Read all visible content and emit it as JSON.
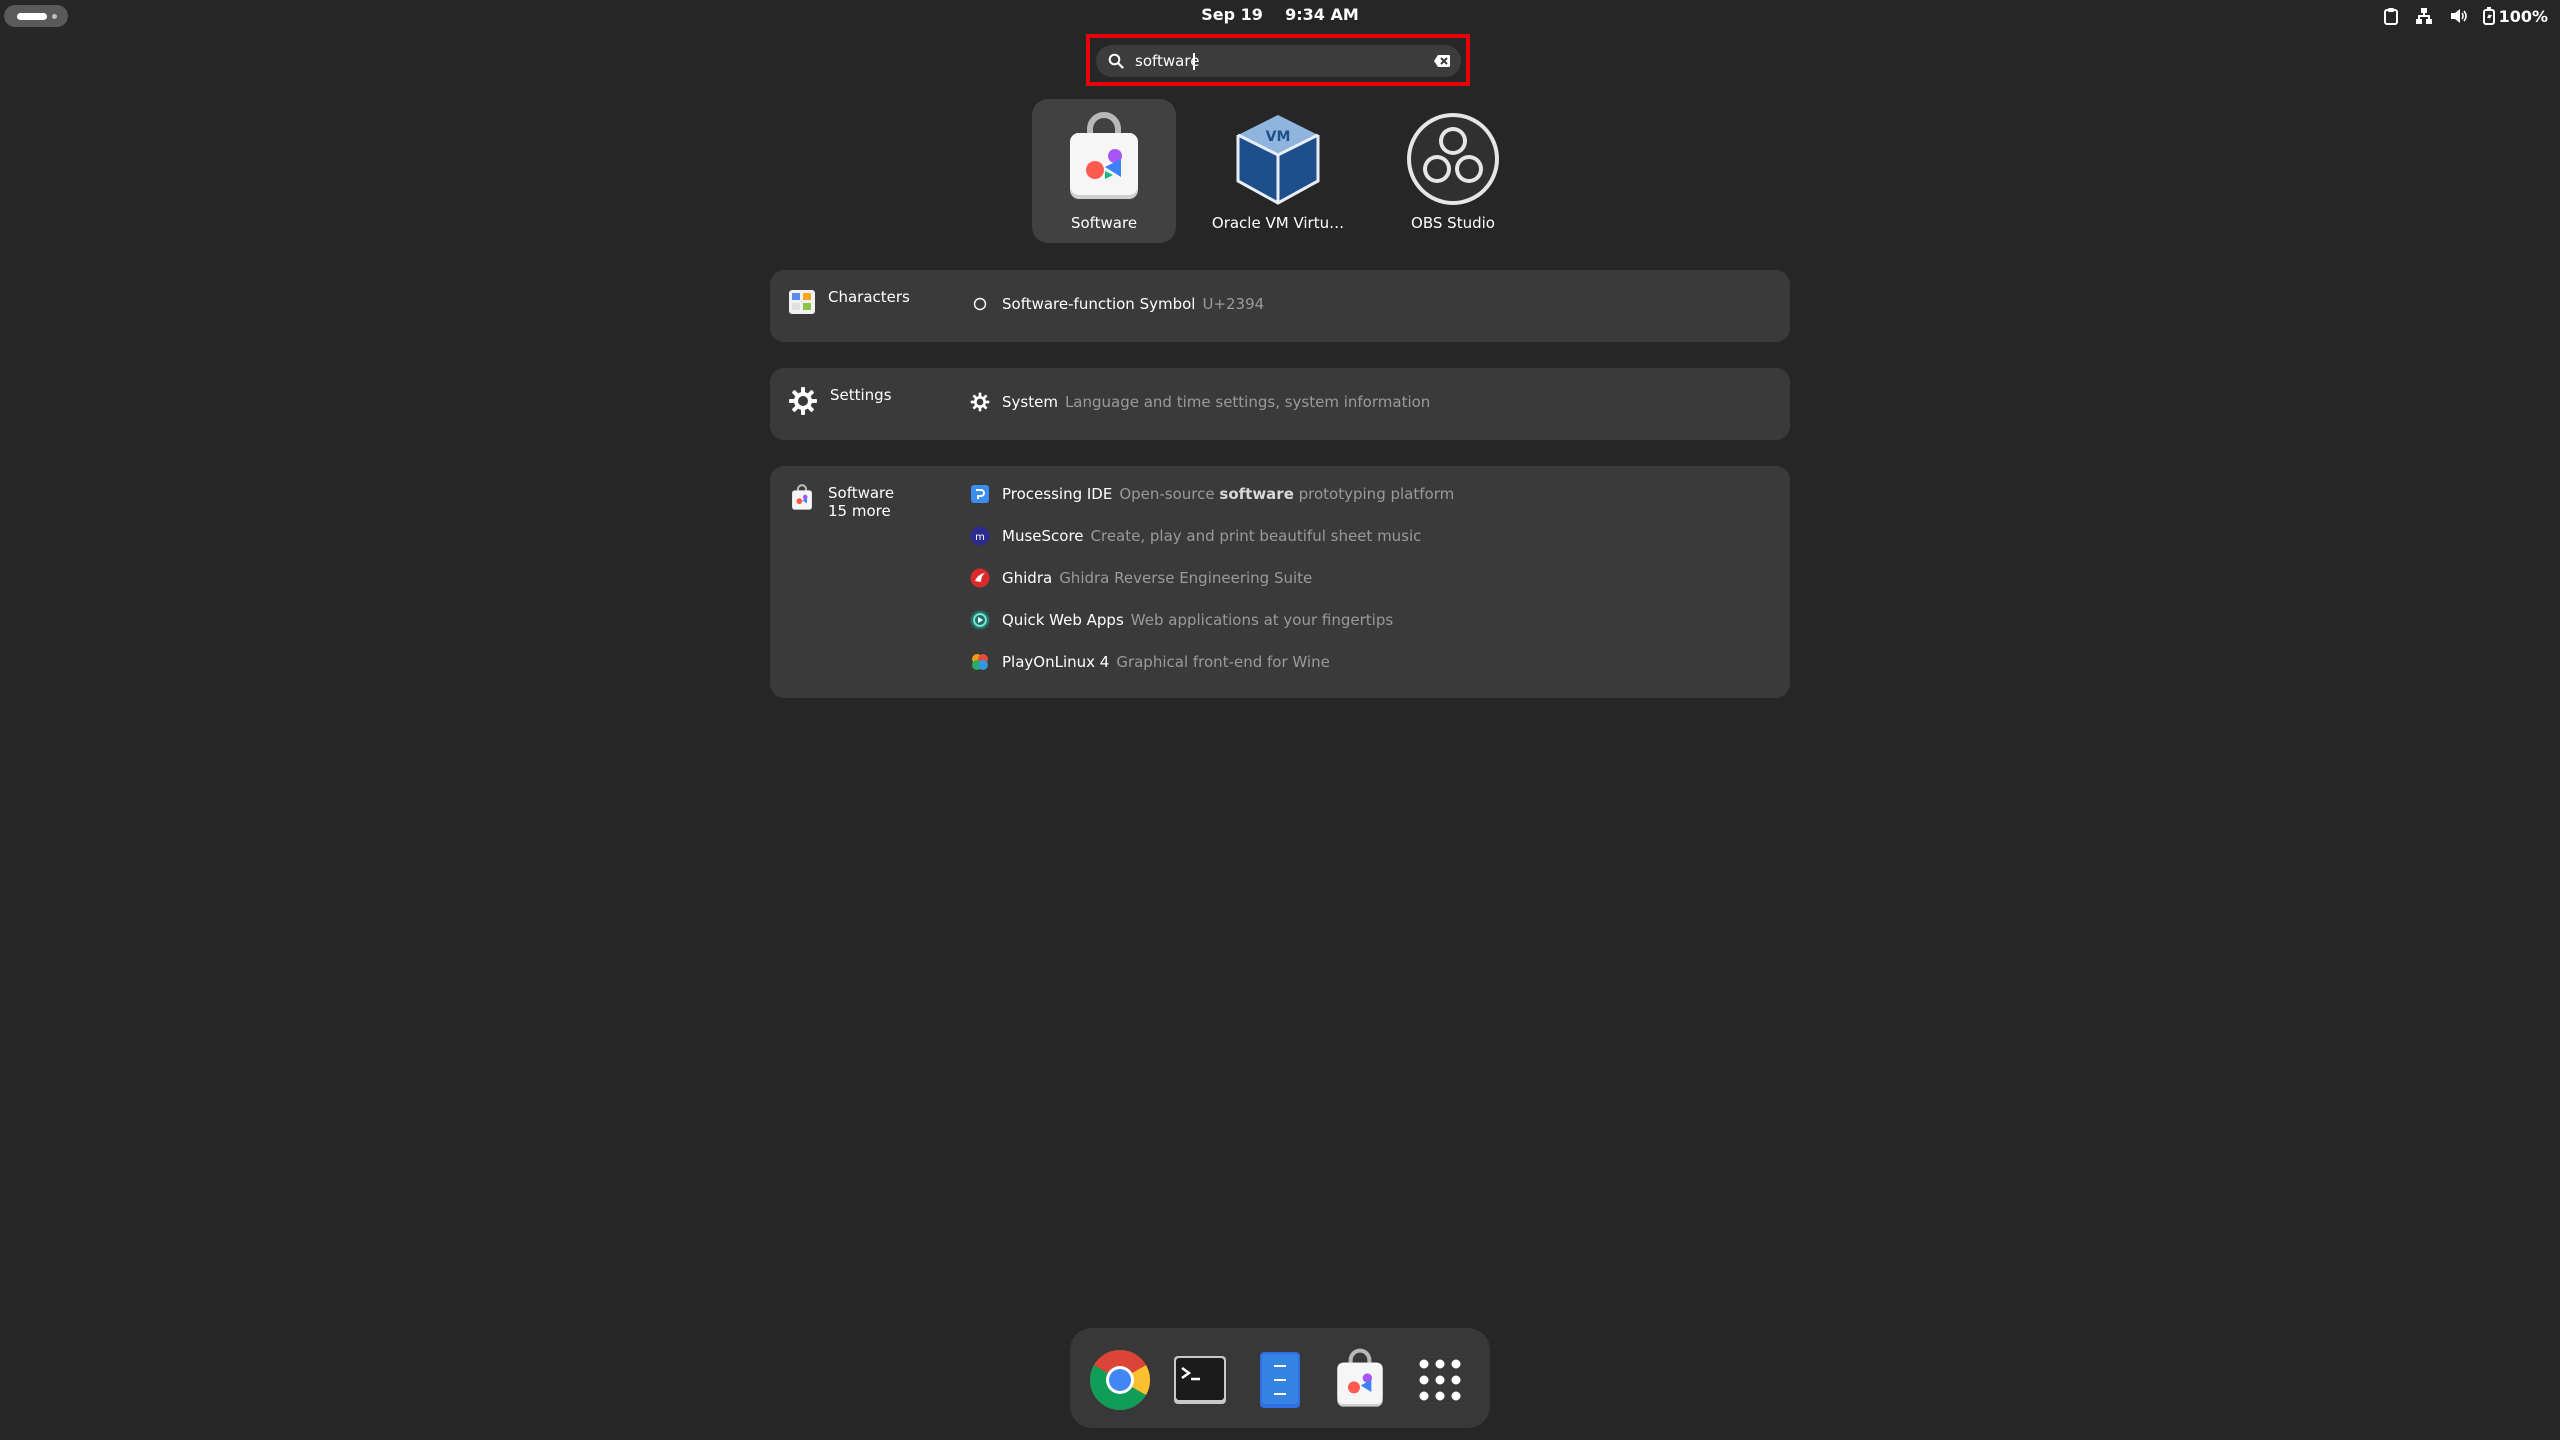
{
  "topbar": {
    "date": "Sep 19",
    "time": "9:34 AM",
    "battery": "100%",
    "tray_icons": [
      "clipboard-icon",
      "network-icon",
      "volume-icon",
      "battery-icon"
    ]
  },
  "search": {
    "value": "software",
    "icon": "search-icon",
    "clear_icon": "clear-icon"
  },
  "apps": [
    {
      "label": "Software",
      "icon": "software-bag-icon",
      "selected": true
    },
    {
      "label": "Oracle VM Virtu…",
      "icon": "virtualbox-icon",
      "selected": false
    },
    {
      "label": "OBS Studio",
      "icon": "obs-icon",
      "selected": false
    }
  ],
  "sections": {
    "characters": {
      "provider": "Characters",
      "results": [
        {
          "title": "Software-function Symbol",
          "desc": "U+2394"
        }
      ]
    },
    "settings": {
      "provider": "Settings",
      "results": [
        {
          "title": "System",
          "desc": "Language and time settings, system information"
        }
      ]
    },
    "software": {
      "provider": "Software",
      "more": "15 more",
      "results": [
        {
          "title": "Processing IDE",
          "desc_before": "Open-source ",
          "desc_bold": "software",
          "desc_after": " prototyping platform"
        },
        {
          "title": "MuseScore",
          "desc": "Create, play and print beautiful sheet music"
        },
        {
          "title": "Ghidra",
          "desc": "Ghidra Reverse Engineering Suite"
        },
        {
          "title": "Quick Web Apps",
          "desc": "Web applications at your fingertips"
        },
        {
          "title": "PlayOnLinux 4",
          "desc": "Graphical front-end for Wine"
        }
      ]
    }
  },
  "dock": [
    "chrome-icon",
    "terminal-icon",
    "text-editor-icon",
    "software-icon",
    "app-grid-icon"
  ],
  "colors": {
    "background": "#262626",
    "section": "#3a3a3a",
    "highlight": "#e8000b",
    "secondary_text": "#9a9a9a"
  }
}
